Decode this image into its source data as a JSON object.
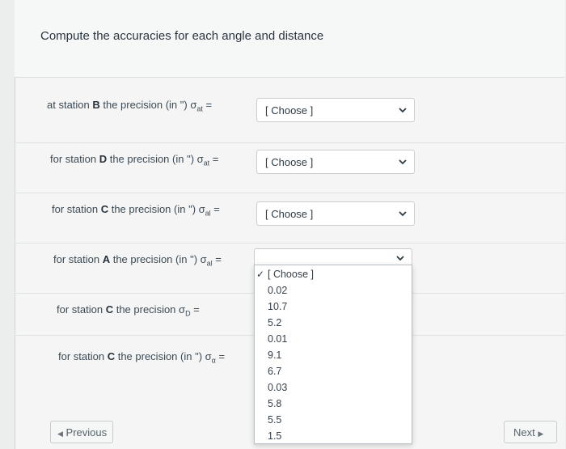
{
  "question": {
    "title": "Compute the accuracies for each angle and distance"
  },
  "rows": [
    {
      "prefix": "at station ",
      "station": "B",
      "suffix": " the precision  (in \") σ",
      "sub": "at",
      "eq": " =",
      "select_value": "[ Choose ]"
    },
    {
      "prefix": "for station ",
      "station": "D",
      "suffix": " the precision  (in \") σ",
      "sub": "at",
      "eq": " =",
      "select_value": "[ Choose ]"
    },
    {
      "prefix": "for station ",
      "station": "C",
      "suffix": " the precision  (in \") σ",
      "sub": "al",
      "eq": " =",
      "select_value": "[ Choose ]"
    },
    {
      "prefix": "for station ",
      "station": "A",
      "suffix": " the precision  (in \") σ",
      "sub": "al",
      "eq": " =",
      "select_value": "[ Choose ]"
    },
    {
      "prefix": "for station ",
      "station": "C",
      "suffix": " the precision σ",
      "sub": "D",
      "eq": " =",
      "select_value": ""
    },
    {
      "prefix": "for station ",
      "station": "C",
      "suffix": " the precision (in \") σ",
      "sub": "α",
      "eq": " =",
      "select_value": ""
    }
  ],
  "dropdown": {
    "options": [
      "[ Choose ]",
      "0.02",
      "10.7",
      "5.2",
      "0.01",
      "9.1",
      "6.7",
      "0.03",
      "5.8",
      "5.5",
      "1.5"
    ],
    "selected_index": 0,
    "check_glyph": "✓"
  },
  "nav": {
    "previous_label": "Previous",
    "next_label": "Next"
  },
  "icons": {
    "chevron": "chevron-down-icon",
    "prev": "triangle-left-icon",
    "next": "triangle-right-icon"
  }
}
